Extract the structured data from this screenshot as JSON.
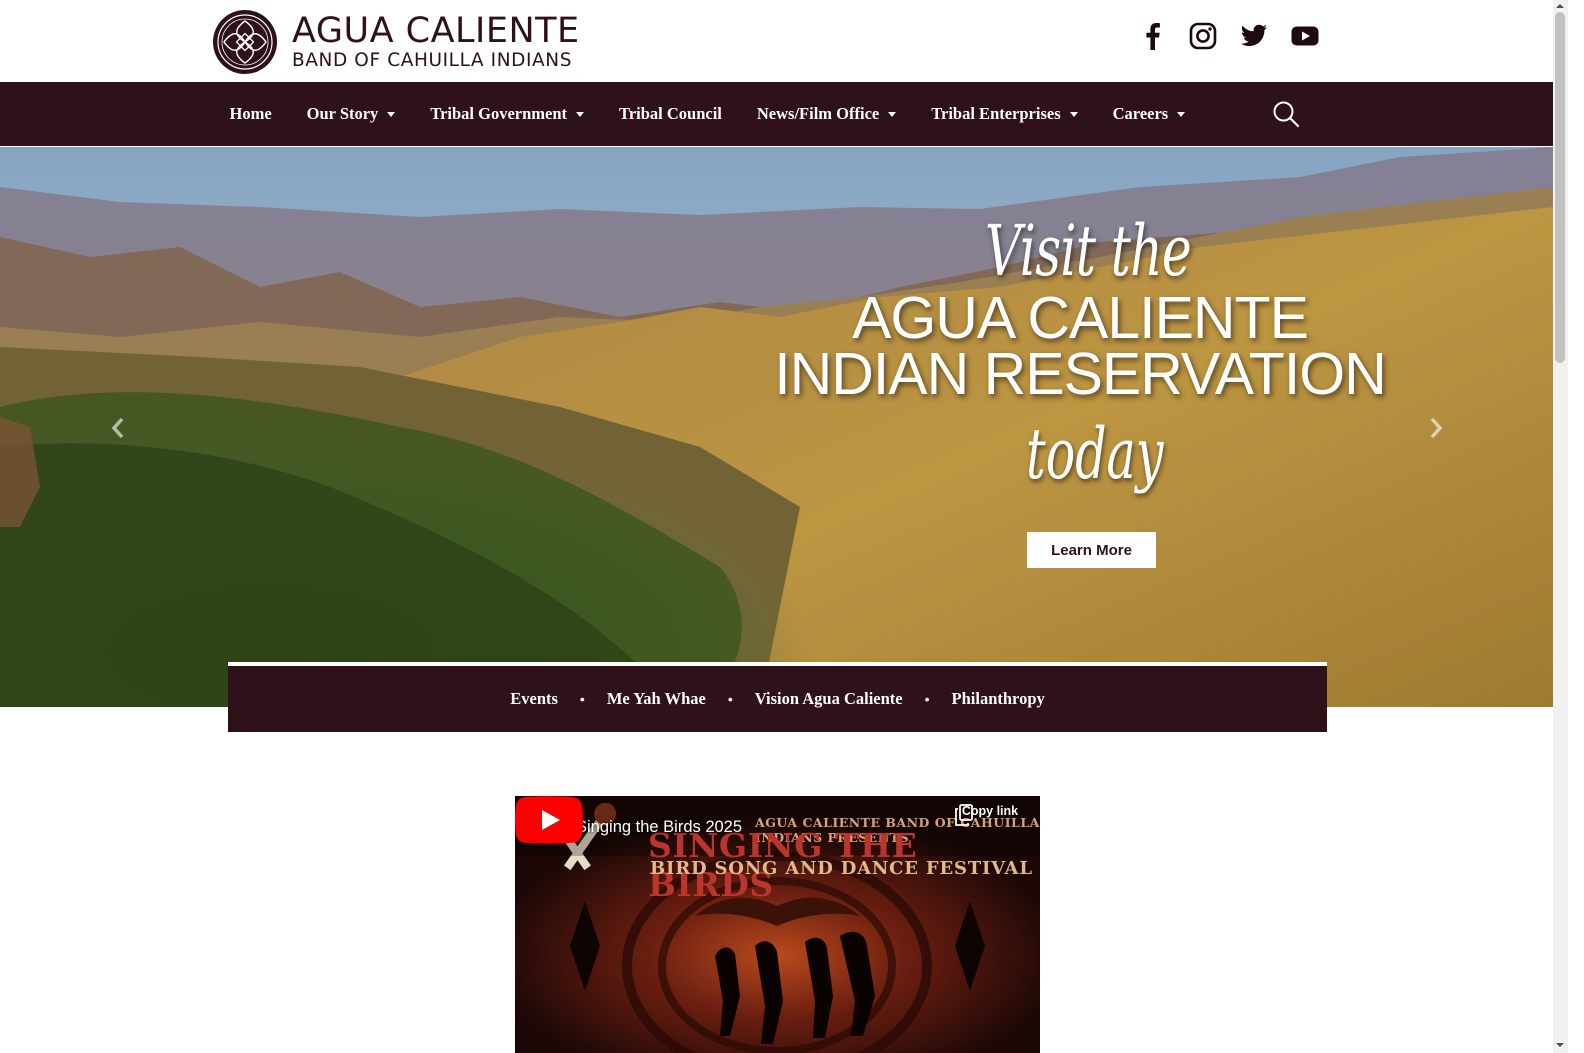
{
  "header": {
    "logo_title": "AGUA CALIENTE",
    "logo_subtitle": "BAND OF CAHUILLA INDIANS",
    "social_icons": [
      "facebook-icon",
      "instagram-icon",
      "twitter-icon",
      "youtube-icon"
    ]
  },
  "nav": {
    "items": [
      {
        "label": "Home",
        "dropdown": false
      },
      {
        "label": "Our Story",
        "dropdown": true
      },
      {
        "label": "Tribal Government",
        "dropdown": true
      },
      {
        "label": "Tribal Council",
        "dropdown": false
      },
      {
        "label": "News/Film Office",
        "dropdown": true
      },
      {
        "label": "Tribal Enterprises",
        "dropdown": true
      },
      {
        "label": "Careers",
        "dropdown": true
      }
    ],
    "search_icon": "search-icon"
  },
  "hero": {
    "line_visit": "Visit the",
    "title_line1": "AGUA CALIENTE",
    "title_line2": "INDIAN RESERVATION",
    "line_today": "today",
    "button_label": "Learn More",
    "prev_icon": "chevron-left-icon",
    "next_icon": "chevron-right-icon"
  },
  "subbar": {
    "links": [
      "Events",
      "Me Yah Whae",
      "Vision Agua Caliente",
      "Philanthropy"
    ],
    "separator": "•"
  },
  "video": {
    "title": "Singing the Birds 2025",
    "copy_link_label": "Copy link",
    "poster_line1": "AGUA CALIENTE BAND OF CAHUILLA INDIANS PRESENTS",
    "poster_line2": "SINGING THE BIRDS",
    "poster_line3": "BIRD SONG AND DANCE FESTIVAL",
    "play_icon": "play-icon"
  },
  "colors": {
    "brand": "#2e1119",
    "white": "#ffffff",
    "youtube_red": "#ff0000"
  }
}
